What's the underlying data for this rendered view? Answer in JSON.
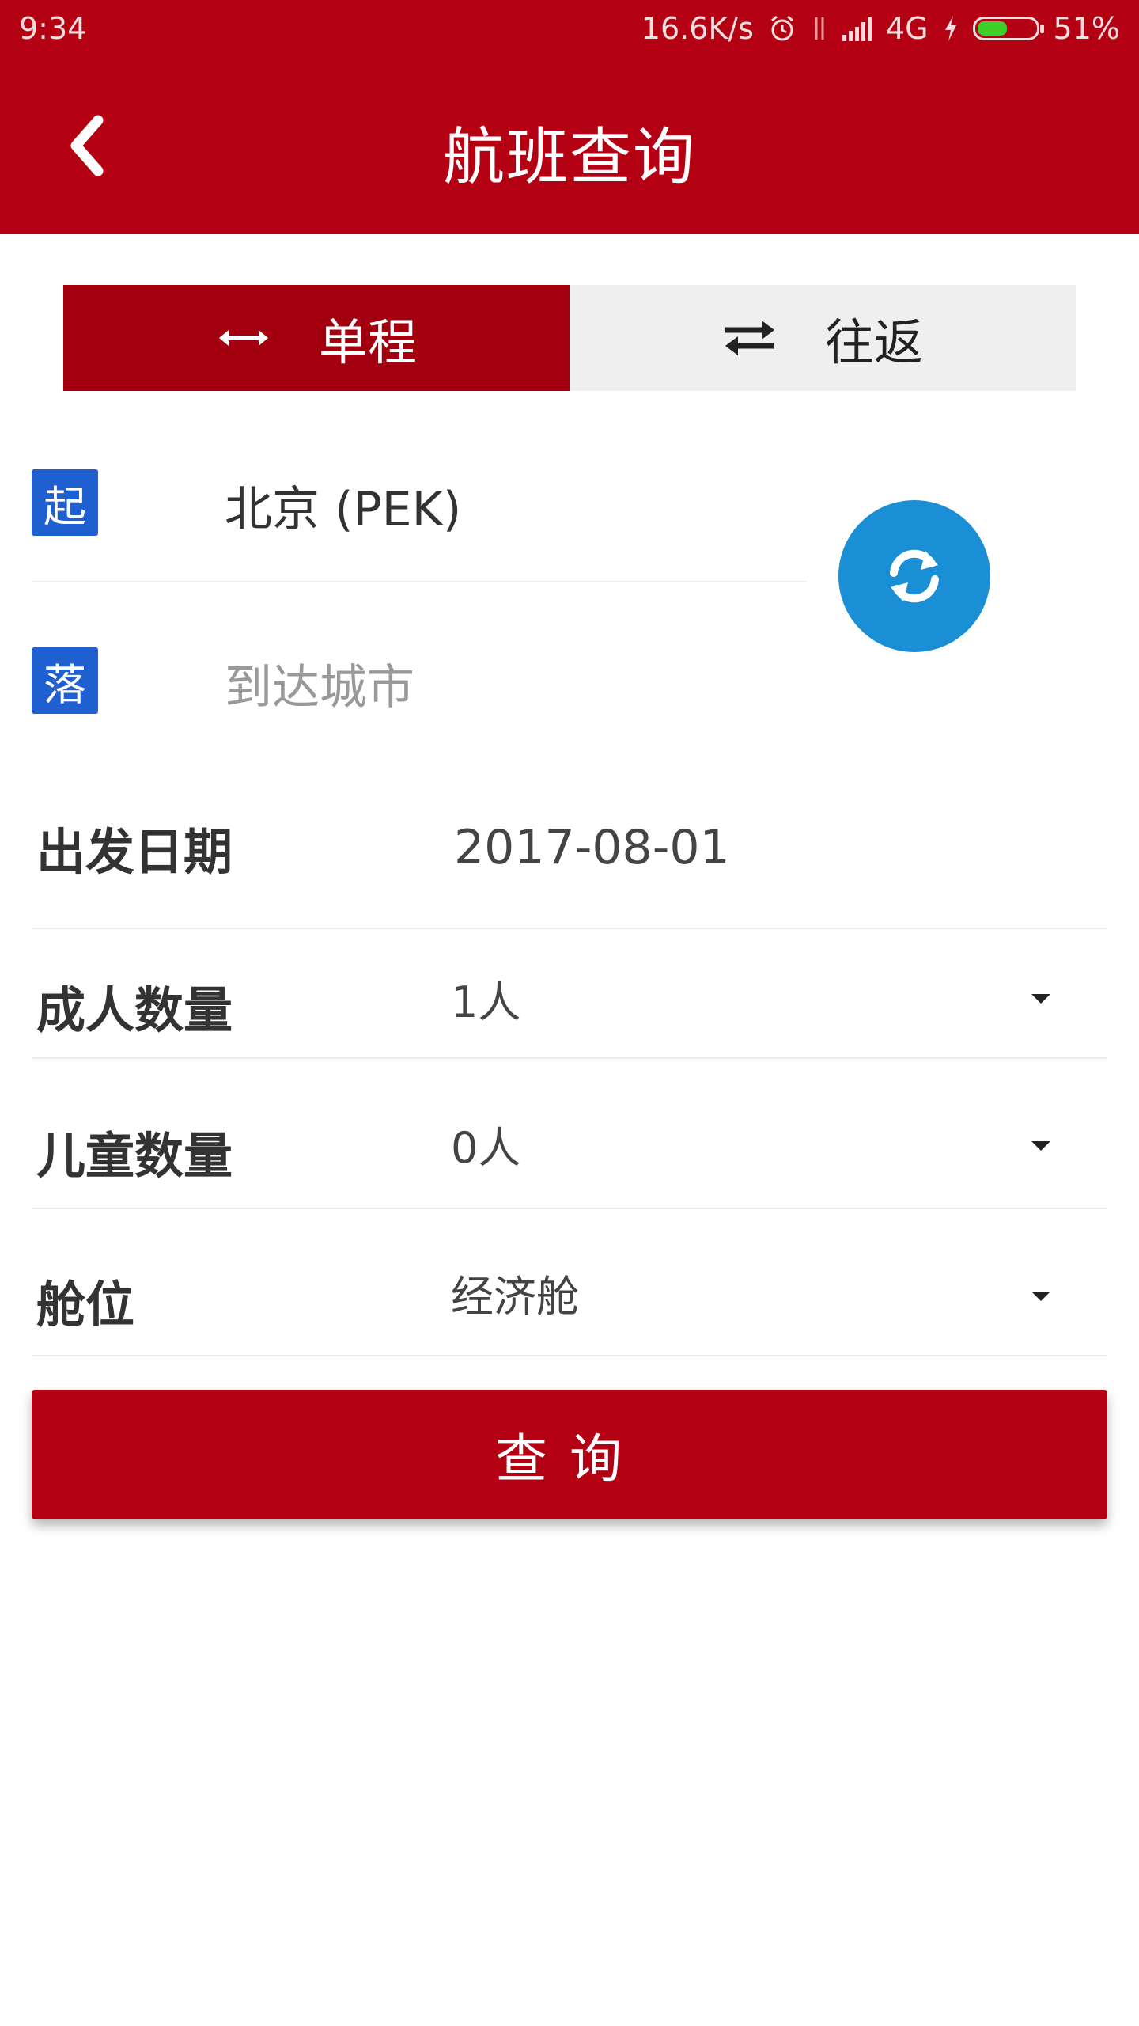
{
  "status_bar": {
    "time": "9:34",
    "net_speed": "16.6K/s",
    "network": "4G",
    "battery": "51%",
    "battery_level": 0.51
  },
  "header": {
    "title": "航班查询"
  },
  "trip_tabs": [
    {
      "label": "单程",
      "active": true
    },
    {
      "label": "往返",
      "active": false
    }
  ],
  "origin": {
    "badge": "起",
    "value": "北京 (PEK)"
  },
  "destination": {
    "badge": "落",
    "placeholder": "到达城市"
  },
  "form": {
    "date_label": "出发日期",
    "date_value": "2017-08-01",
    "adults_label": "成人数量",
    "adults_value": "1人",
    "children_label": "儿童数量",
    "children_value": "0人",
    "cabin_label": "舱位",
    "cabin_value": "经济舱"
  },
  "search_button": {
    "label": "查询"
  },
  "colors": {
    "brand_red": "#b30013",
    "active_tab": "#a3000f",
    "badge_blue": "#1f5fd0",
    "swap_blue": "#1a8fd6"
  },
  "icons": {
    "back": "chevron-left-icon",
    "one_way": "arrow-left-right-icon",
    "round_trip": "swap-horizontal-icon",
    "swap": "refresh-icon"
  }
}
